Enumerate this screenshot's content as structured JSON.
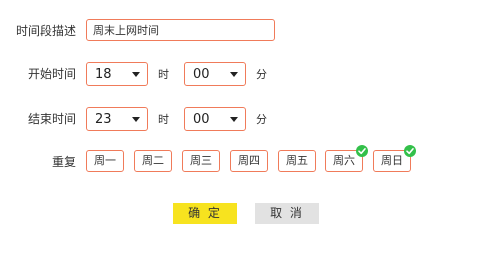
{
  "form": {
    "desc_label": "时间段描述",
    "desc_value": "周末上网时间",
    "start_label": "开始时间",
    "start_hour": "18",
    "start_minute": "00",
    "end_label": "结束时间",
    "end_hour": "23",
    "end_minute": "00",
    "hour_unit": "时",
    "minute_unit": "分",
    "repeat_label": "重复"
  },
  "days": [
    {
      "label": "周一",
      "checked": false
    },
    {
      "label": "周二",
      "checked": false
    },
    {
      "label": "周三",
      "checked": false
    },
    {
      "label": "周四",
      "checked": false
    },
    {
      "label": "周五",
      "checked": false
    },
    {
      "label": "周六",
      "checked": true
    },
    {
      "label": "周日",
      "checked": true
    }
  ],
  "buttons": {
    "ok": "确 定",
    "cancel": "取 消"
  },
  "colors": {
    "border": "#f07b5a",
    "check": "#33c04a",
    "ok_bg": "#f7e31f",
    "cancel_bg": "#e2e2e2"
  }
}
